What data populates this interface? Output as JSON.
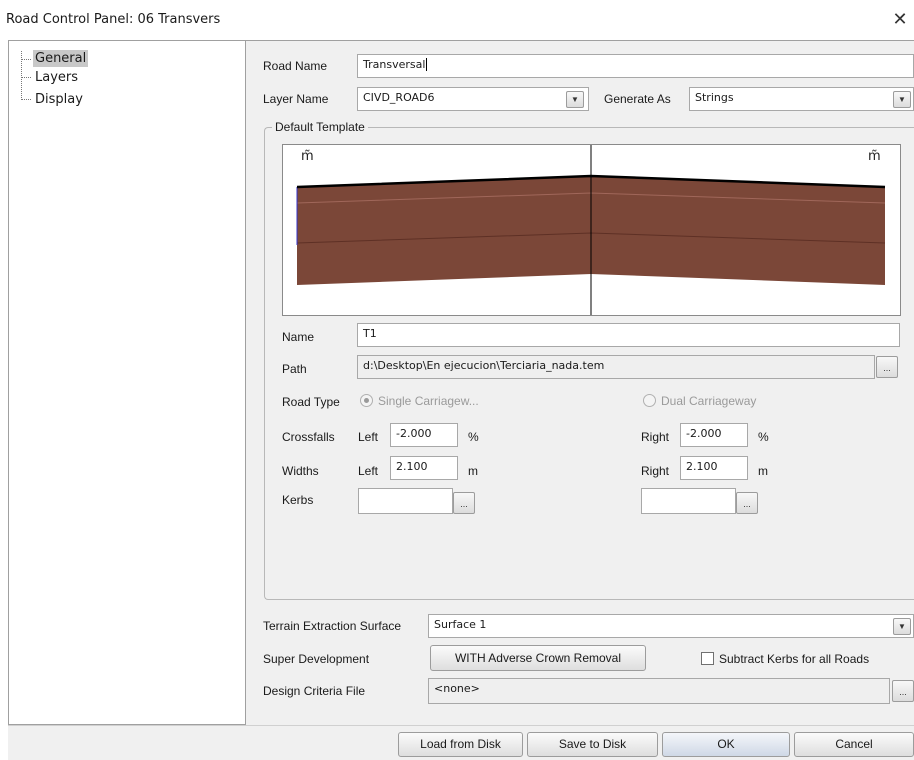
{
  "window": {
    "title": "Road Control Panel: 06  Transvers",
    "close_glyph": "✕"
  },
  "tree": {
    "items": [
      {
        "label": "General",
        "selected": true
      },
      {
        "label": "Layers",
        "selected": false
      },
      {
        "label": "Display",
        "selected": false
      }
    ]
  },
  "road": {
    "name_label": "Road Name",
    "name_value": "Transversal",
    "layer_label": "Layer Name",
    "layer_value": "CIVD_ROAD6",
    "generate_label": "Generate As",
    "generate_value": "Strings"
  },
  "template": {
    "group_title": "Default Template",
    "preview_left_marker": "m̃",
    "preview_right_marker": "m̃",
    "fill_color": "#7b4738",
    "name_label": "Name",
    "name_value": "T1",
    "path_label": "Path",
    "path_value": "d:\\Desktop\\En ejecucion\\Terciaria_nada.tem",
    "road_type_label": "Road Type",
    "single_label": "Single Carriagew...",
    "dual_label": "Dual Carriageway",
    "crossfalls_label": "Crossfalls",
    "widths_label": "Widths",
    "kerbs_label": "Kerbs",
    "left_label": "Left",
    "right_label": "Right",
    "crossfall_left": "-2.000",
    "crossfall_right": "-2.000",
    "crossfall_unit": "%",
    "width_left": "2.100",
    "width_right": "2.100",
    "width_unit": "m",
    "kerb_left": "",
    "kerb_right": ""
  },
  "terrain": {
    "label": "Terrain Extraction Surface",
    "value": "Surface 1"
  },
  "super_dev": {
    "label": "Super Development",
    "button_label": "WITH Adverse Crown Removal",
    "subtract_label": "Subtract Kerbs for all Roads",
    "subtract_checked": false
  },
  "design": {
    "label": "Design Criteria File",
    "value": "<none>"
  },
  "buttons": {
    "load": "Load from Disk",
    "save": "Save to Disk",
    "ok": "OK",
    "cancel": "Cancel",
    "ellipsis": "...",
    "dropdown_glyph": "▼"
  }
}
